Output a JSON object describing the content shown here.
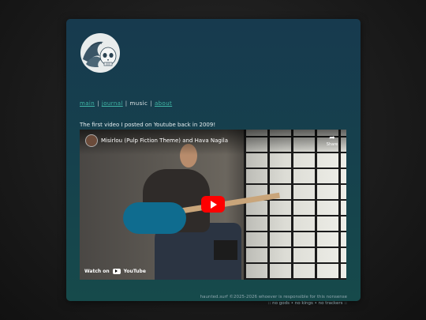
{
  "nav": {
    "items": [
      {
        "label": "main"
      },
      {
        "label": "journal"
      },
      {
        "label": "music"
      },
      {
        "label": "about"
      }
    ],
    "separator": "|"
  },
  "content": {
    "intro": "The first video I posted on Youtube back in 2009!"
  },
  "video": {
    "title": "Misirlou (Pulp Fiction Theme) and Hava Nagila",
    "share_label": "Share",
    "watch_label": "Watch on",
    "youtube_label": "YouTube"
  },
  "footer": {
    "line1": "haunted.surf ©2025-2026 whoever is responsible for this nonsense",
    "line2": ":: no gods • no kings • no trackers ::"
  },
  "colors": {
    "link": "#3fb6a6",
    "play_button": "#ff0000"
  }
}
